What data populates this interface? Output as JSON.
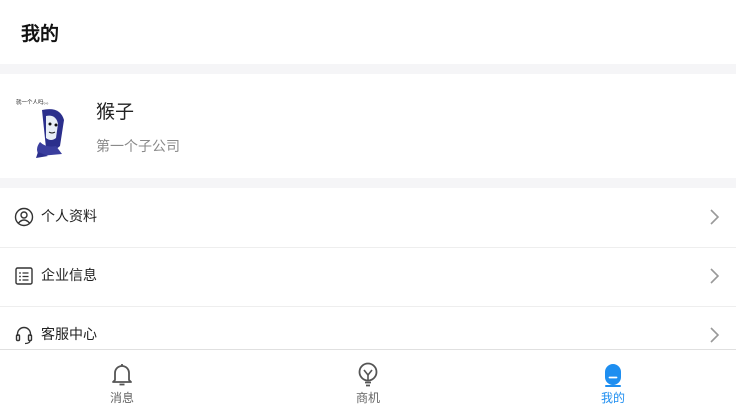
{
  "header": {
    "title": "我的"
  },
  "profile": {
    "name": "猴子",
    "company": "第一个子公司",
    "avatar_caption": "就一个人吗。。"
  },
  "menu": {
    "items": [
      {
        "label": "个人资料",
        "icon": "user-circle-icon"
      },
      {
        "label": "企业信息",
        "icon": "list-icon"
      },
      {
        "label": "客服中心",
        "icon": "headset-icon"
      }
    ]
  },
  "tabbar": {
    "tabs": [
      {
        "label": "消息",
        "icon": "bell-icon",
        "active": false
      },
      {
        "label": "商机",
        "icon": "lightbulb-icon",
        "active": false
      },
      {
        "label": "我的",
        "icon": "user-icon",
        "active": true
      }
    ]
  },
  "colors": {
    "accent": "#1e8ef0",
    "inactive": "#666666",
    "background": "#f5f5f7"
  }
}
